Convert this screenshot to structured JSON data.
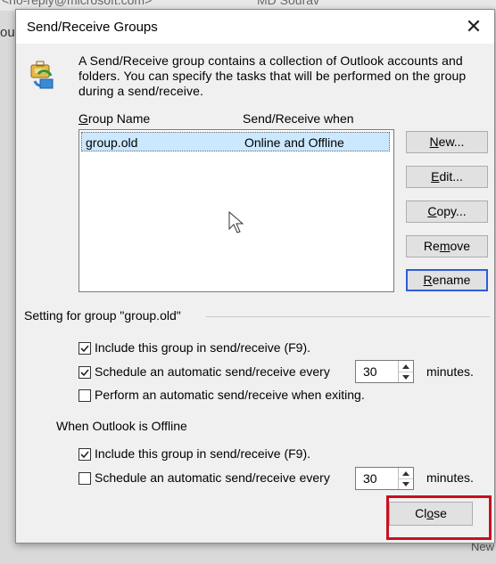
{
  "background": {
    "top_email": "<no-reply@microsoft.com>",
    "top_name": "MD Sourav",
    "left_fragment": "ou",
    "bottom_right": "New"
  },
  "dialog": {
    "title": "Send/Receive Groups",
    "close_glyph": "✕",
    "intro_text": "A Send/Receive group contains a collection of Outlook accounts and folders. You can specify the tasks that will be performed on the group during a send/receive.",
    "columns": {
      "group_name_prefix": "",
      "group_name_hotkey": "G",
      "group_name_rest": "roup Name",
      "when": "Send/Receive when"
    },
    "groups": [
      {
        "name": "group.old",
        "when": "Online and Offline",
        "selected": true
      }
    ],
    "buttons": {
      "new": {
        "hotkey": "N",
        "rest": "ew..."
      },
      "edit": {
        "hotkey": "E",
        "rest": "dit..."
      },
      "copy": {
        "hotkey": "C",
        "rest": "opy..."
      },
      "remove_pre": "Re",
      "remove_hotkey": "m",
      "remove_rest": "ove",
      "rename": {
        "hotkey": "R",
        "rest": "ename"
      },
      "close_pre": "Cl",
      "close_hotkey": "o",
      "close_rest": "se"
    },
    "setting_section": {
      "label": "Setting for group \"group.old\"",
      "options": [
        {
          "label": "Include this group in send/receive (F9).",
          "checked": true
        },
        {
          "label": "Schedule an automatic send/receive every",
          "checked": true,
          "value": "30",
          "unit": "minutes."
        },
        {
          "label": "Perform an automatic send/receive when exiting.",
          "checked": false
        }
      ]
    },
    "offline_section": {
      "label": "When Outlook is Offline",
      "options": [
        {
          "label": "Include this group in send/receive (F9).",
          "checked": true
        },
        {
          "label": "Schedule an automatic send/receive every",
          "checked": false,
          "value": "30",
          "unit": "minutes."
        }
      ]
    },
    "highlight_color": "#c8101e",
    "selection_color": "#cce8ff",
    "default_button_border": "#2c5ed8"
  }
}
